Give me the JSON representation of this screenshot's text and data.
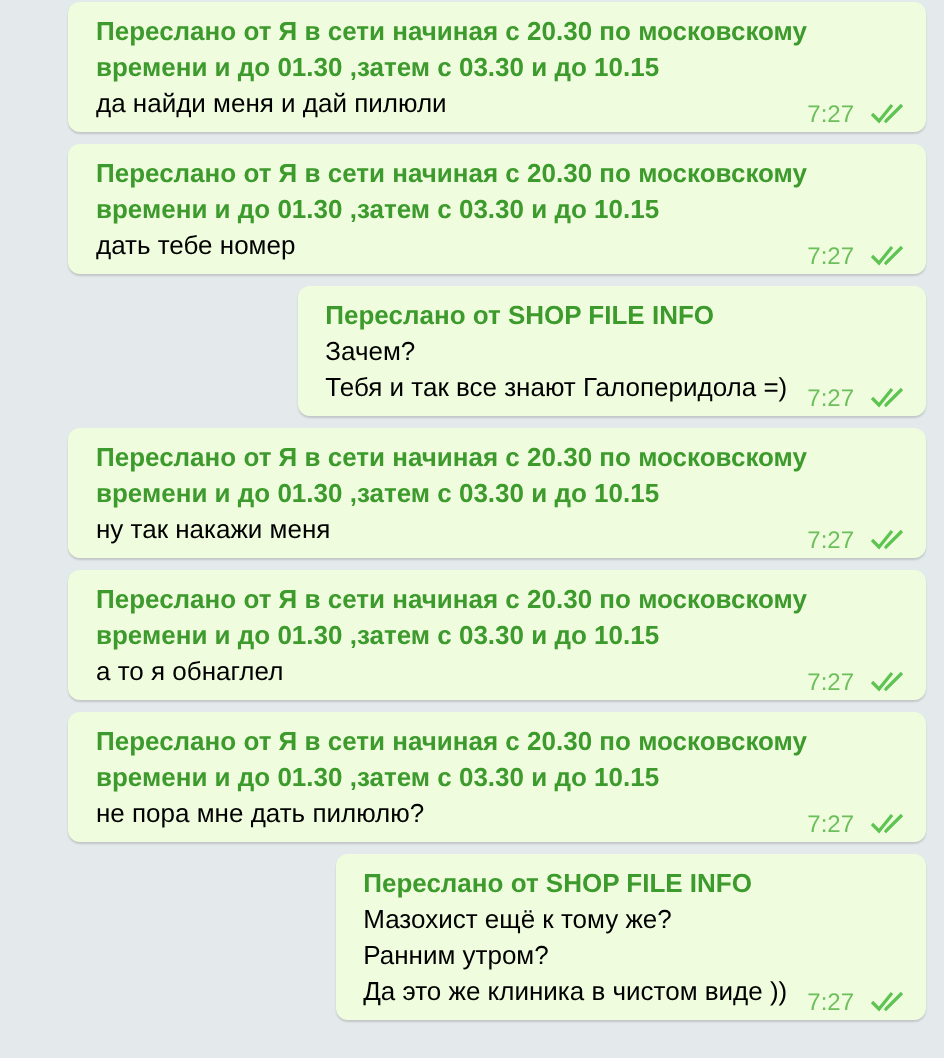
{
  "messages": [
    {
      "forwarded_from": "Переслано от Я в сети начиная с 20.30 по московскому времени и до 01.30 ,затем с 03.30 и до 10.15",
      "lines": [
        "да найди меня и дай пилюли"
      ],
      "time": "7:27",
      "read": true,
      "wide": true
    },
    {
      "forwarded_from": "Переслано от Я в сети начиная с 20.30 по московскому времени и до 01.30 ,затем с 03.30 и до 10.15",
      "lines": [
        "дать тебе номер"
      ],
      "time": "7:27",
      "read": true,
      "wide": true
    },
    {
      "forwarded_from": "Переслано от SHOP FILE INFO",
      "lines": [
        "Зачем?",
        "Тебя и так все знают Галоперидола =)"
      ],
      "time": "7:27",
      "read": true,
      "wide": false
    },
    {
      "forwarded_from": "Переслано от Я в сети начиная с 20.30 по московскому времени и до 01.30 ,затем с 03.30 и до 10.15",
      "lines": [
        "ну так накажи меня"
      ],
      "time": "7:27",
      "read": true,
      "wide": true
    },
    {
      "forwarded_from": "Переслано от Я в сети начиная с 20.30 по московскому времени и до 01.30 ,затем с 03.30 и до 10.15",
      "lines": [
        "а то я обнаглел"
      ],
      "time": "7:27",
      "read": true,
      "wide": true
    },
    {
      "forwarded_from": "Переслано от Я в сети начиная с 20.30 по московскому времени и до 01.30 ,затем с 03.30 и до 10.15",
      "lines": [
        "не пора мне дать пилюлю?"
      ],
      "time": "7:27",
      "read": true,
      "wide": true
    },
    {
      "forwarded_from": "Переслано от SHOP FILE INFO",
      "lines": [
        "Мазохист ещё к тому же?",
        "Ранним утром?",
        "Да это же клиника в чистом виде ))"
      ],
      "time": "7:27",
      "read": true,
      "wide": false
    }
  ]
}
